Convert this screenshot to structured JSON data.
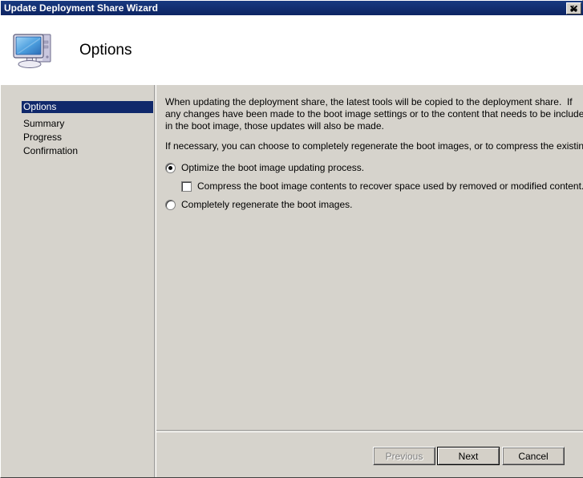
{
  "window": {
    "title": "Update Deployment Share Wizard",
    "close_label": "Close",
    "close_icon": "close-icon"
  },
  "header": {
    "title": "Options",
    "icon": "computer-icon"
  },
  "sidebar": {
    "items": [
      {
        "label": "Options",
        "active": true
      },
      {
        "label": "Summary",
        "active": false
      },
      {
        "label": "Progress",
        "active": false
      },
      {
        "label": "Confirmation",
        "active": false
      }
    ]
  },
  "content": {
    "paragraph1": "When updating the deployment share, the latest tools will be copied to the deployment share.  If any changes have been made to the boot image settings or to the content that needs to be included in the boot image, those updates will also be made.",
    "paragraph2": "If necessary, you can choose to completely regenerate the boot images, or to compress the existing boot",
    "options": {
      "optimize": {
        "label": "Optimize the boot image updating process.",
        "selected": true
      },
      "compress": {
        "label": "Compress the boot image contents to recover space used by removed or modified content.",
        "checked": false
      },
      "regenerate": {
        "label": "Completely regenerate the boot images.",
        "selected": false
      }
    }
  },
  "buttons": {
    "previous": {
      "label": "Previous",
      "enabled": false
    },
    "next": {
      "label": "Next",
      "default": true
    },
    "cancel": {
      "label": "Cancel"
    }
  },
  "colors": {
    "titlebar": "#10286b",
    "highlight": "#10286b",
    "window_face": "#d4d0c8",
    "body_face": "#d6d3cc",
    "header_bg": "#ffffff",
    "text": "#000000",
    "disabled_text": "#808080"
  }
}
